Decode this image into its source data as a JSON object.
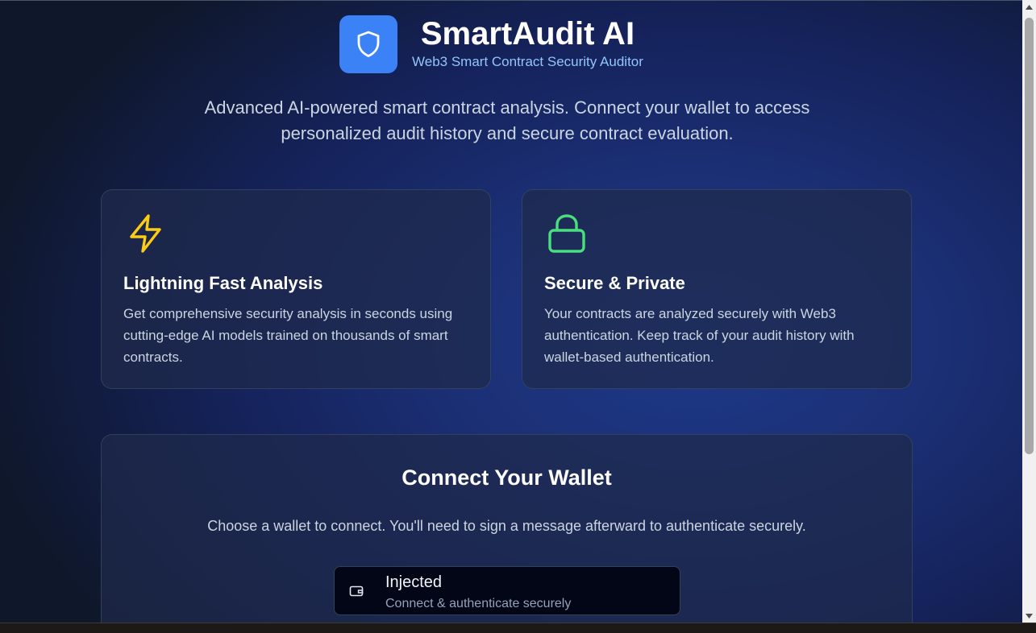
{
  "header": {
    "title": "SmartAudit AI",
    "subtitle": "Web3 Smart Contract Security Auditor",
    "logo_icon": "shield-icon"
  },
  "intro": "Advanced AI-powered smart contract analysis. Connect your wallet to access personalized audit history and secure contract evaluation.",
  "features": [
    {
      "icon": "lightning-icon",
      "title": "Lightning Fast Analysis",
      "text": "Get comprehensive security analysis in seconds using cutting-edge AI models trained on thousands of smart contracts."
    },
    {
      "icon": "lock-icon",
      "title": "Secure & Private",
      "text": "Your contracts are analyzed securely with Web3 authentication. Keep track of your audit history with wallet-based authentication."
    }
  ],
  "wallet": {
    "title": "Connect Your Wallet",
    "subtitle": "Choose a wallet to connect. You'll need to sign a message afterward to authenticate securely.",
    "options": [
      {
        "icon": "wallet-icon",
        "name": "Injected",
        "description": "Connect & authenticate securely"
      }
    ]
  },
  "colors": {
    "accent": "#3b82f6",
    "subtitle": "#93c5fd",
    "lightning": "#facc15",
    "lock": "#4ade80"
  }
}
